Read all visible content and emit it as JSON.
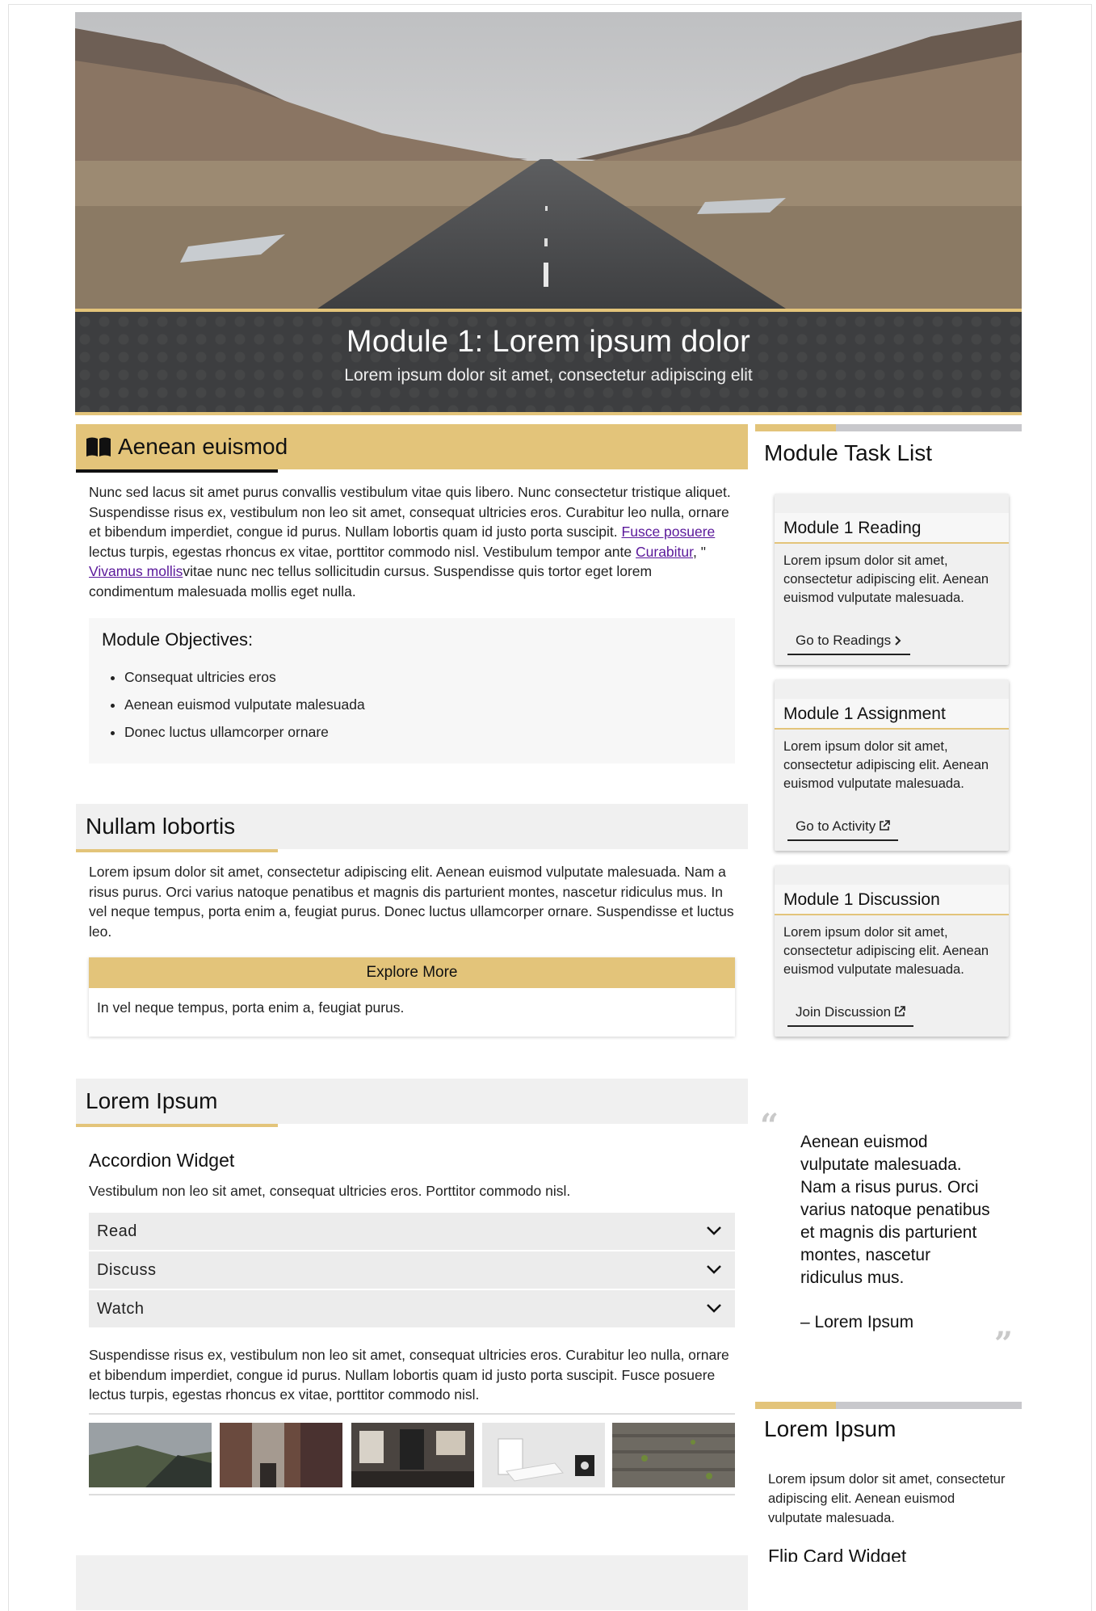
{
  "banner": {
    "title": "Module 1: Lorem ipsum dolor",
    "subtitle": "Lorem ipsum dolor sit amet, consectetur adipiscing elit"
  },
  "section1": {
    "heading": "Aenean euismod",
    "icon": "book-open-icon",
    "para_a": "Nunc sed lacus sit amet purus convallis vestibulum vitae quis libero. Nunc consectetur tristique aliquet. Suspendisse risus ex, vestibulum non leo sit amet, consequat ultricies eros. Curabitur leo nulla, ornare et bibendum imperdiet, congue id purus. Nullam lobortis quam id justo porta suscipit. ",
    "link1": "Fusce posuere",
    "para_b": " lectus turpis, egestas rhoncus ex vitae, porttitor commodo nisl. Vestibulum tempor ante ",
    "link2": "Curabitur",
    "para_c": ", \" ",
    "link3": "Vivamus mollis",
    "para_d": "vitae nunc nec tellus sollicitudin cursus. Suspendisse quis tortor eget lorem condimentum malesuada mollis eget nulla.",
    "objectives_title": "Module Objectives:",
    "objectives": [
      "Consequat ultricies eros",
      "Aenean euismod vulputate malesuada",
      "Donec luctus ullamcorper ornare"
    ]
  },
  "section2": {
    "heading": "Nullam lobortis",
    "para": "Lorem ipsum dolor sit amet, consectetur adipiscing elit. Aenean euismod vulputate malesuada. Nam a risus purus. Orci varius natoque penatibus et magnis dis parturient montes, nascetur ridiculus mus. In vel neque tempus, porta enim a, feugiat purus. Donec luctus ullamcorper ornare. Suspendisse et luctus leo.",
    "explore_label": "Explore More",
    "explore_text": "In vel neque tempus, porta enim a, feugiat purus."
  },
  "section3": {
    "heading": "Lorem Ipsum",
    "widget_title": "Accordion Widget",
    "widget_intro": "Vestibulum non leo sit amet, consequat ultricies eros. Porttitor commodo nisl.",
    "accordion": [
      "Read",
      "Discuss",
      "Watch"
    ],
    "after_text": "Suspendisse risus ex, vestibulum non leo sit amet, consequat ultricies eros. Curabitur leo nulla, ornare et bibendum imperdiet, congue id purus. Nullam lobortis quam id justo porta suscipit. Fusce posuere lectus turpis, egestas rhoncus ex vitae, porttitor commodo nisl."
  },
  "tasks": {
    "title": "Module Task List",
    "cards": [
      {
        "title": "Module 1 Reading",
        "body": "Lorem ipsum dolor sit amet, consectetur adipiscing elit. Aenean euismod vulputate malesuada.",
        "link": "Go to Readings",
        "icon": "chevron-right-icon"
      },
      {
        "title": "Module 1 Assignment",
        "body": "Lorem ipsum dolor sit amet, consectetur adipiscing elit. Aenean euismod vulputate malesuada.",
        "link": "Go to Activity",
        "icon": "external-link-icon"
      },
      {
        "title": "Module 1 Discussion",
        "body": "Lorem ipsum dolor sit amet, consectetur adipiscing elit. Aenean euismod vulputate malesuada.",
        "link": "Join Discussion",
        "icon": "external-link-icon"
      }
    ]
  },
  "quote": {
    "text": "Aenean euismod vulputate malesuada. Nam a risus purus. Orci varius natoque penatibus et magnis dis parturient montes, nascetur ridiculus mus.",
    "author": "– Lorem Ipsum"
  },
  "side2": {
    "title": "Lorem Ipsum",
    "body": "Lorem ipsum dolor sit amet, consectetur adipiscing elit. Aenean euismod vulputate malesuada.",
    "widget_title": "Flip Card Widget"
  },
  "colors": {
    "accent_gold": "#e3c47a",
    "banner_dark": "#3d3e40",
    "link_purple": "#5a189a"
  }
}
